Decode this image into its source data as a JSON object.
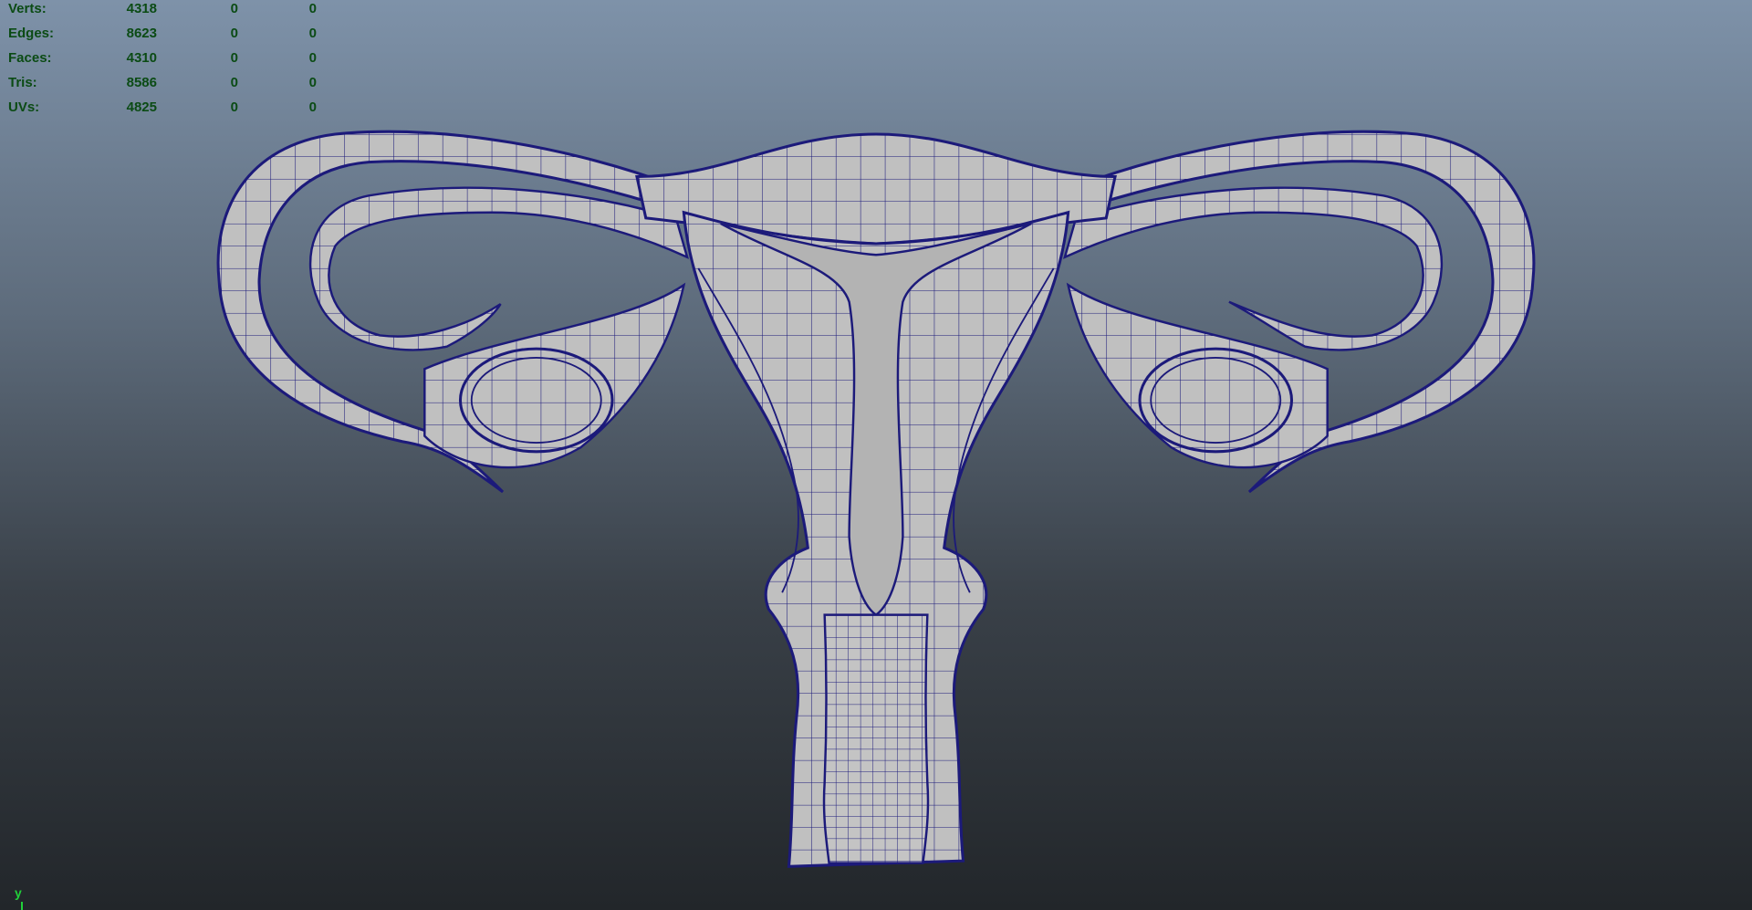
{
  "hud": {
    "rows": [
      {
        "label": "Verts:",
        "v0": "4318",
        "v1": "0",
        "v2": "0"
      },
      {
        "label": "Edges:",
        "v0": "8623",
        "v1": "0",
        "v2": "0"
      },
      {
        "label": "Faces:",
        "v0": "4310",
        "v1": "0",
        "v2": "0"
      },
      {
        "label": "Tris:",
        "v0": "8586",
        "v1": "0",
        "v2": "0"
      },
      {
        "label": "UVs:",
        "v0": "4825",
        "v1": "0",
        "v2": "0"
      }
    ]
  },
  "axis": {
    "label": "y"
  },
  "colors": {
    "hud_text": "#0b4b14",
    "wire": "#1c1a7a",
    "surface": "#bdbdbd",
    "axis": "#21d13a",
    "background_top": "#7e92a9",
    "background_bottom": "#22262a"
  }
}
